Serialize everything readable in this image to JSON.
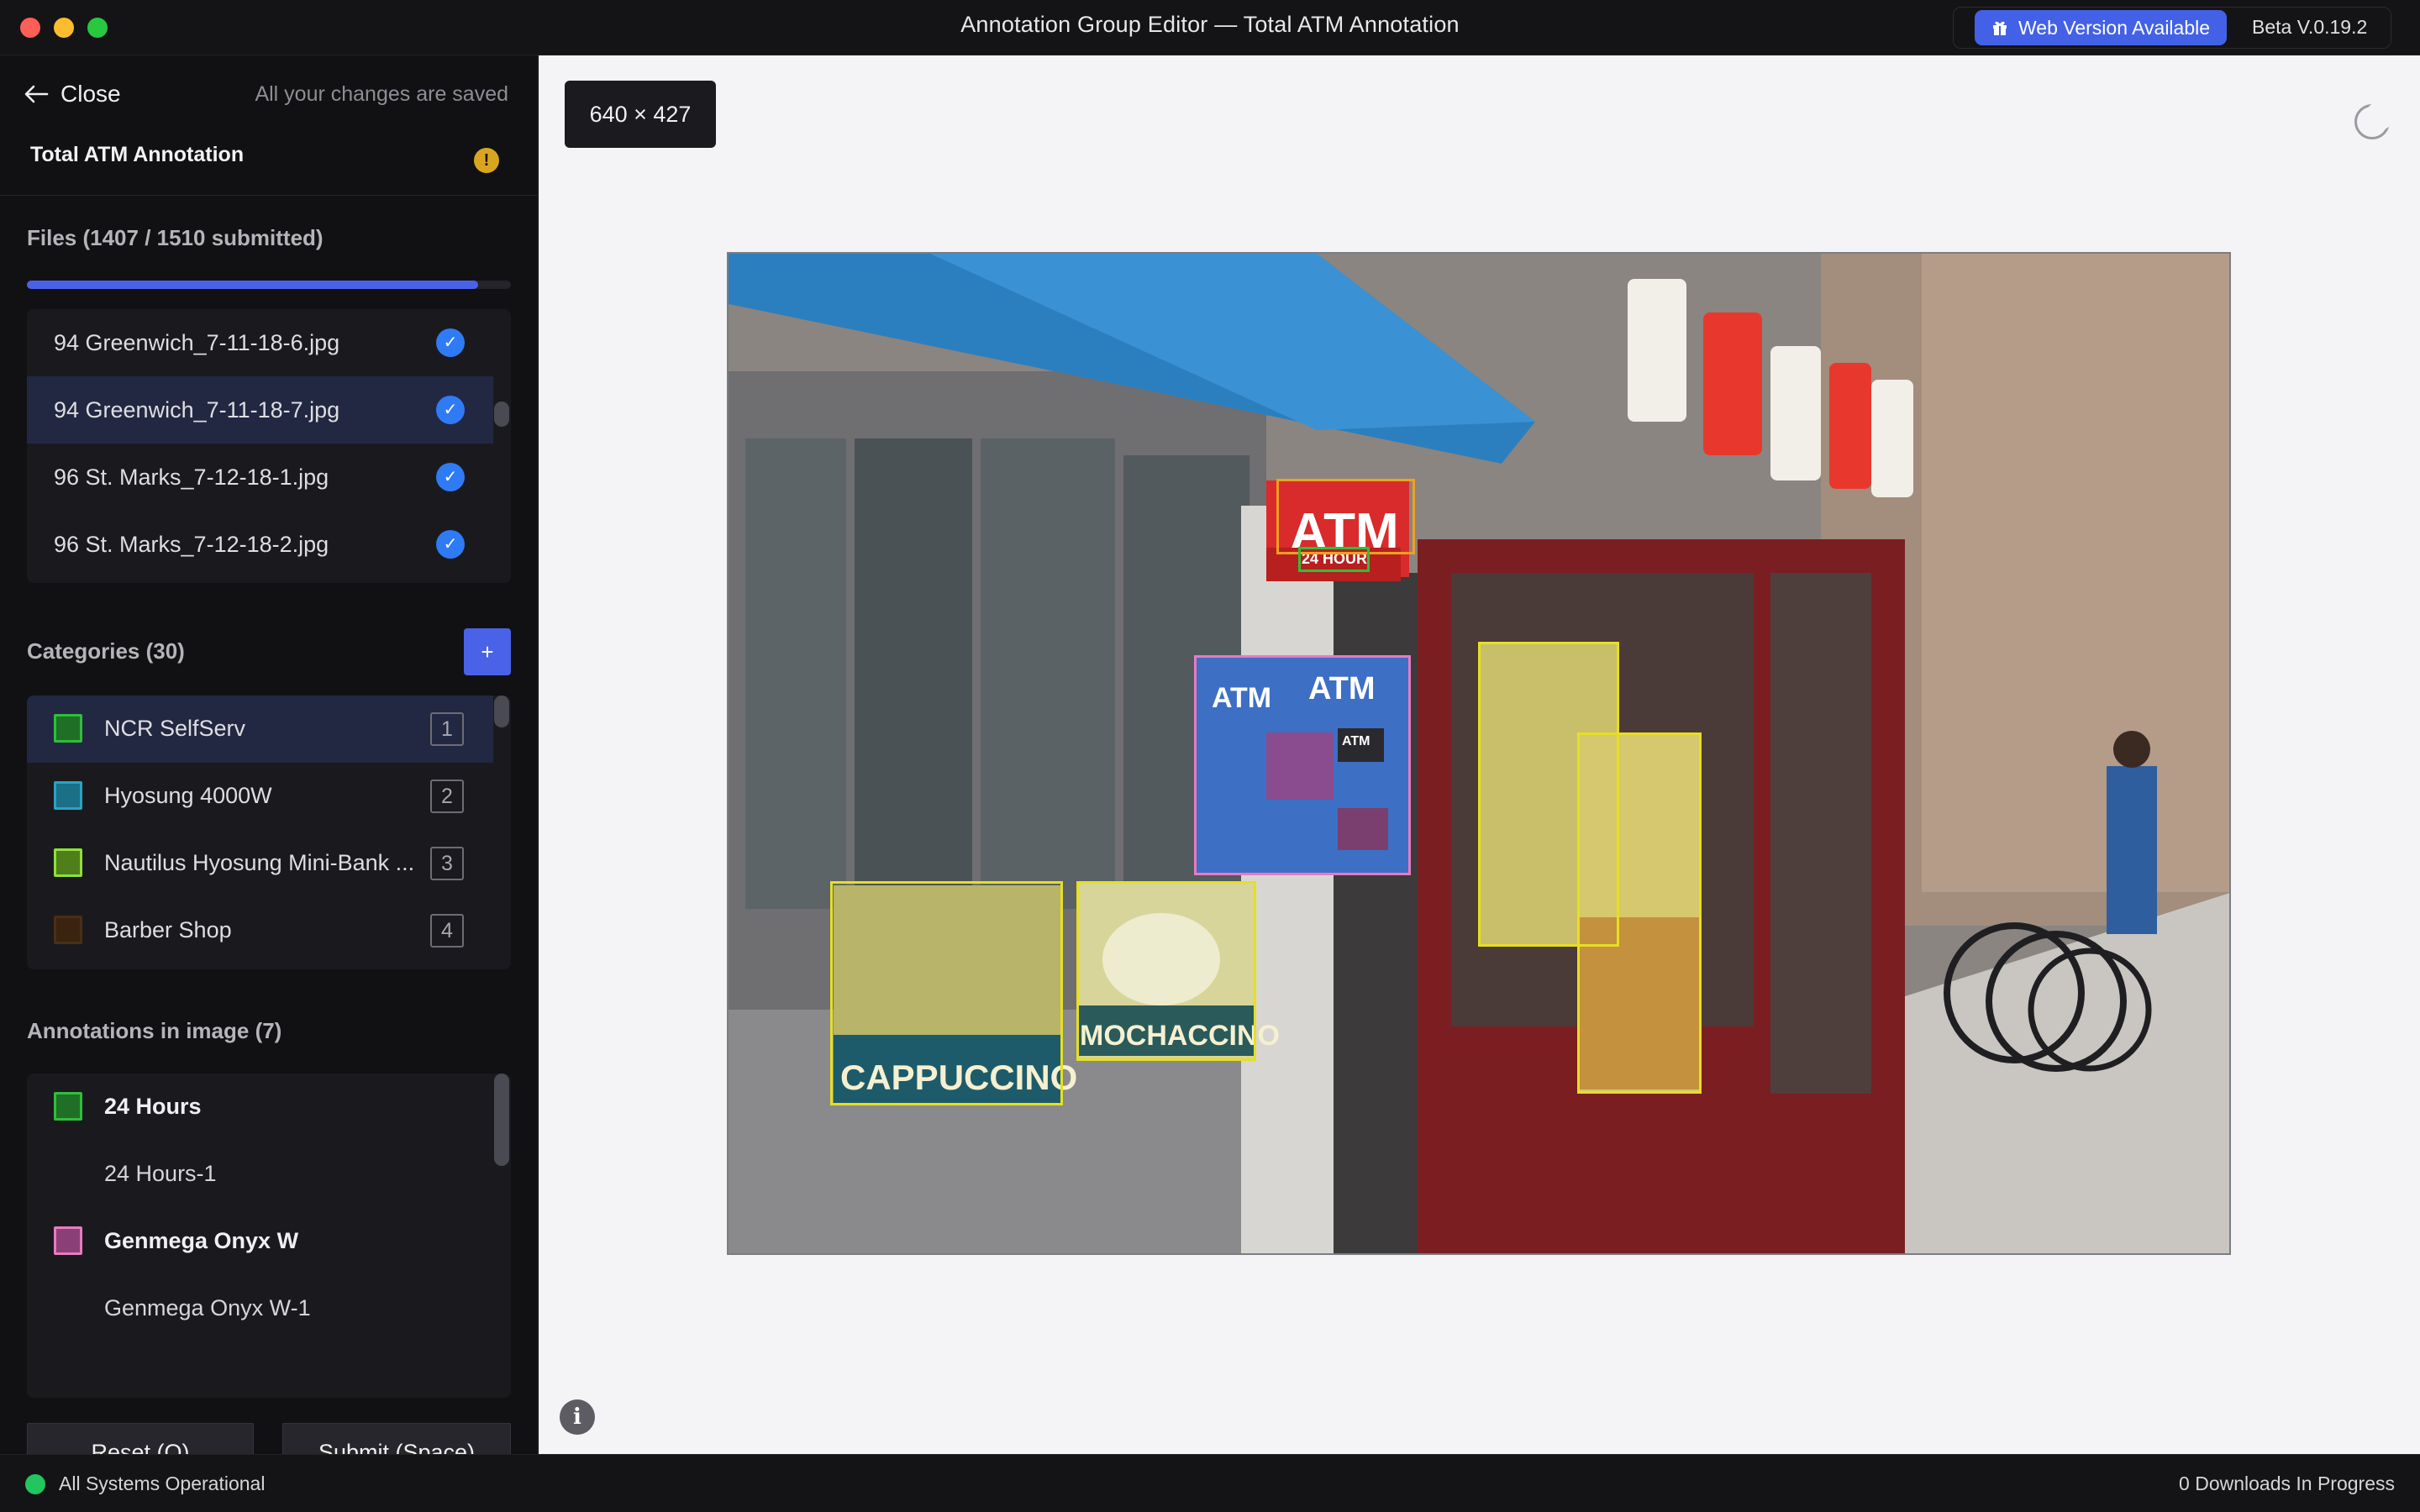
{
  "window": {
    "title": "Annotation Group Editor — Total ATM Annotation",
    "web_version_label": "Web Version Available",
    "version": "Beta V.0.19.2"
  },
  "sidebar": {
    "close_label": "Close",
    "saved_status": "All your changes are saved",
    "project_title": "Total ATM Annotation",
    "files": {
      "header": "Files (1407 / 1510 submitted)",
      "submitted": 1407,
      "total": 1510,
      "items": [
        {
          "name": "94 Greenwich_7-11-18-6.jpg",
          "submitted": true
        },
        {
          "name": "94 Greenwich_7-11-18-7.jpg",
          "submitted": true,
          "selected": true
        },
        {
          "name": "96 St. Marks_7-12-18-1.jpg",
          "submitted": true
        },
        {
          "name": "96 St. Marks_7-12-18-2.jpg",
          "submitted": true
        }
      ]
    },
    "categories": {
      "header": "Categories (30)",
      "add_label": "+",
      "items": [
        {
          "label": "NCR SelfServ",
          "hotkey": "1",
          "color": "#1f8f2f"
        },
        {
          "label": "Hyosung 4000W",
          "hotkey": "2",
          "color": "#29a3c4"
        },
        {
          "label": "Nautilus Hyosung Mini-Bank ...",
          "hotkey": "3",
          "color": "#7ed321"
        },
        {
          "label": "Barber Shop",
          "hotkey": "4",
          "color": "#5a3a1c"
        }
      ]
    },
    "annotations": {
      "header": "Annotations in image (7)",
      "items": [
        {
          "label": "24 Hours",
          "type": "group",
          "color": "#1f8f2f"
        },
        {
          "label": "24 Hours-1",
          "type": "item"
        },
        {
          "label": "Genmega Onyx W",
          "type": "group",
          "color": "#e07ac8"
        },
        {
          "label": "Genmega Onyx W-1",
          "type": "item"
        }
      ]
    },
    "reset_label": "Reset (Q)",
    "submit_label": "Submit (Space)"
  },
  "canvas": {
    "image_dimensions": "640 × 427",
    "photo_text": {
      "atm_sign": "ATM",
      "hours_sign": "24 HOUR",
      "kiosk_left": "ATM",
      "kiosk_right": "ATM",
      "kiosk_screen": "ATM",
      "poster_1": "CAPPUCCINO",
      "poster_2": "MOCHACCINO"
    }
  },
  "status": {
    "system": "All Systems Operational",
    "downloads": "0 Downloads In Progress"
  },
  "colors": {
    "accent": "#4a62e8",
    "check": "#2f7bf5",
    "status_ok": "#22c55e",
    "bbox_yellow": "#e6df22",
    "bbox_pink": "#e87ac0",
    "bbox_orange": "#f0a020",
    "bbox_green": "#2fbf3a"
  }
}
